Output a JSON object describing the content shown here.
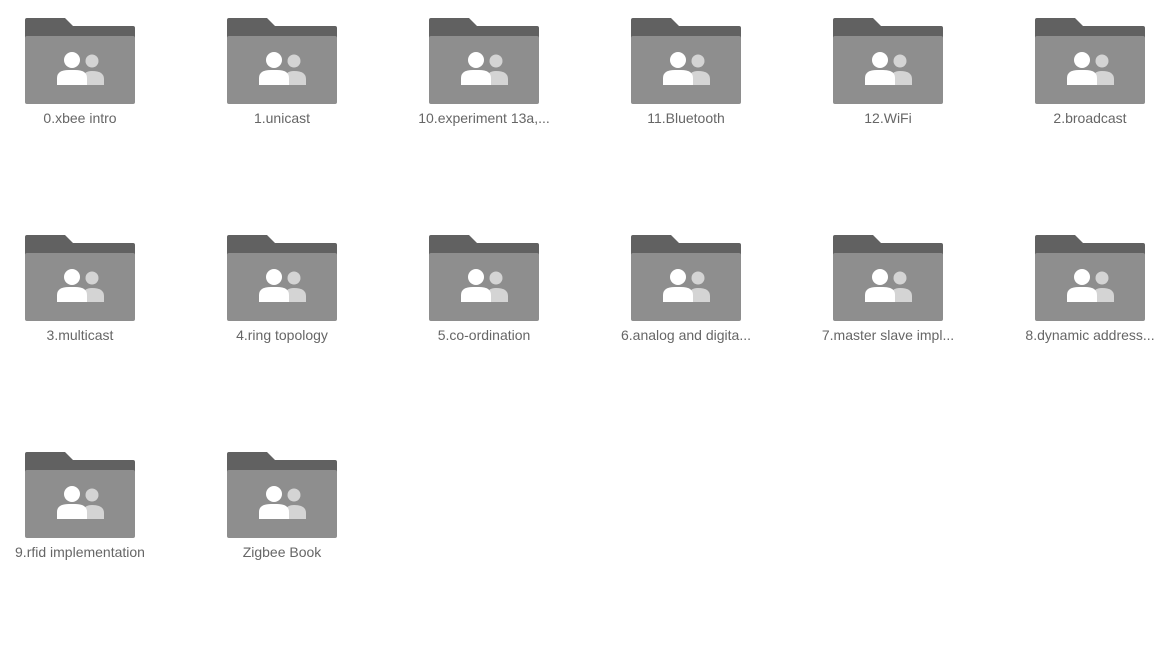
{
  "colors": {
    "folder_tab": "#616161",
    "folder_body": "#8e8e8e",
    "person_front": "#ffffff",
    "person_back": "#d4d4d4",
    "label_text": "#666666"
  },
  "folder_icon": "shared-folder-icon",
  "folders": [
    {
      "label": "0.xbee intro"
    },
    {
      "label": "1.unicast"
    },
    {
      "label": "10.experiment 13a,..."
    },
    {
      "label": "11.Bluetooth"
    },
    {
      "label": "12.WiFi"
    },
    {
      "label": "2.broadcast"
    },
    {
      "label": "3.multicast"
    },
    {
      "label": "4.ring topology"
    },
    {
      "label": "5.co-ordination"
    },
    {
      "label": "6.analog and digita..."
    },
    {
      "label": "7.master slave impl..."
    },
    {
      "label": "8.dynamic address..."
    },
    {
      "label": "9.rfid implementation"
    },
    {
      "label": "Zigbee Book"
    }
  ]
}
